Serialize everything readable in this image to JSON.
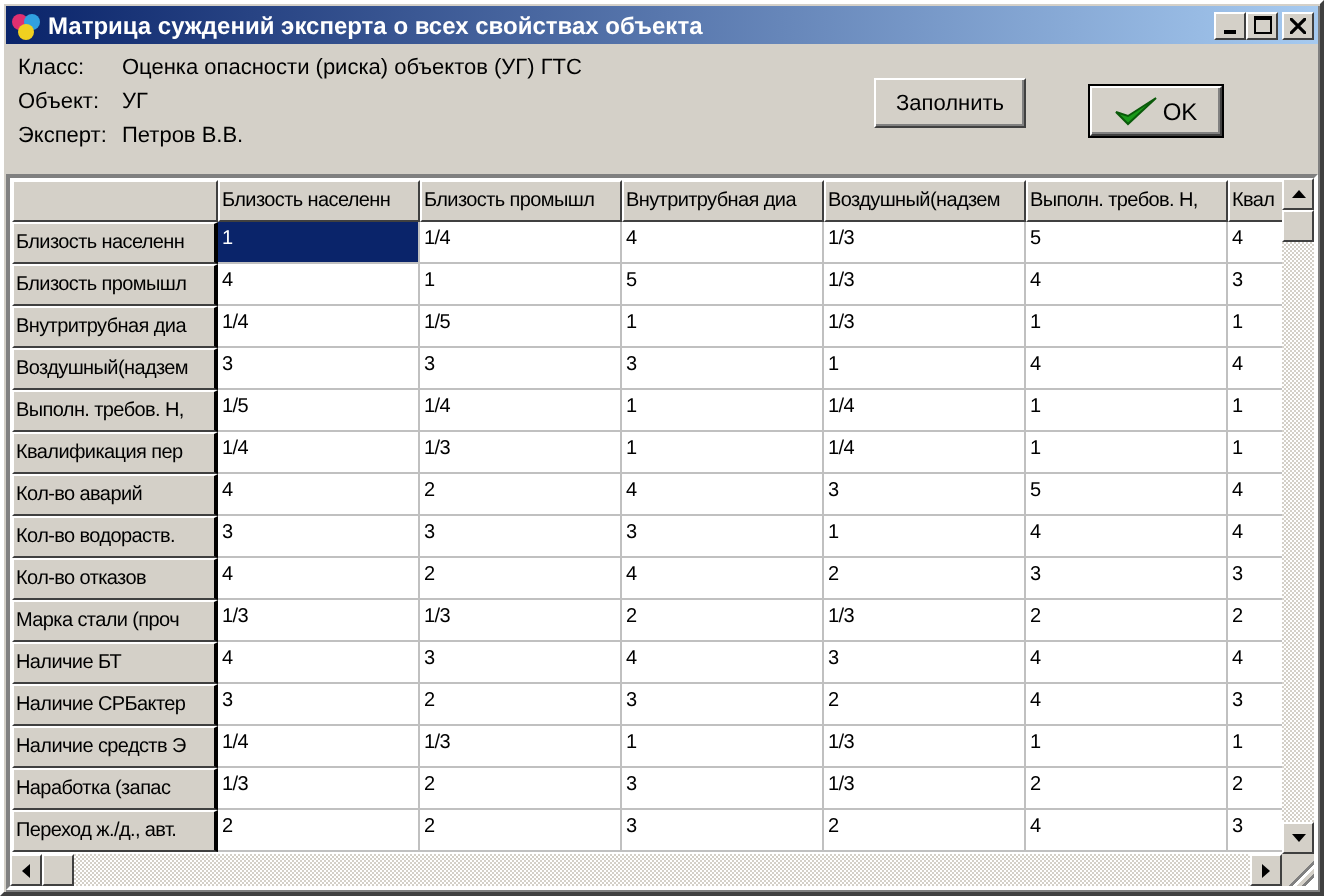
{
  "window": {
    "title": "Матрица суждений эксперта о всех свойствах объекта"
  },
  "info": [
    {
      "label": "Класс:",
      "value": "Оценка опасности (риска) объектов (УГ) ГТС"
    },
    {
      "label": "Объект:",
      "value": "УГ"
    },
    {
      "label": "Эксперт:",
      "value": "Петров В.В."
    }
  ],
  "buttons": [
    {
      "kind": "plain",
      "label": "Заполнить",
      "default": false
    },
    {
      "kind": "ok",
      "label": "OK",
      "default": true
    }
  ],
  "table": {
    "columns": [
      "Близость населенн",
      "Близость промышл",
      "Внутритрубная диа",
      "Воздушный(надзем",
      "Выполн. требов. Н,",
      "Квал"
    ],
    "rows": [
      {
        "label": "Близость населенн",
        "cells": [
          {
            "value": "1",
            "selected": true
          },
          {
            "value": "1/4",
            "selected": false
          },
          {
            "value": "4",
            "selected": false
          },
          {
            "value": "1/3",
            "selected": false
          },
          {
            "value": "5",
            "selected": false
          },
          {
            "value": "4",
            "selected": false
          }
        ]
      },
      {
        "label": "Близость промышл",
        "cells": [
          {
            "value": "4",
            "selected": false
          },
          {
            "value": "1",
            "selected": false
          },
          {
            "value": "5",
            "selected": false
          },
          {
            "value": "1/3",
            "selected": false
          },
          {
            "value": "4",
            "selected": false
          },
          {
            "value": "3",
            "selected": false
          }
        ]
      },
      {
        "label": "Внутритрубная диа",
        "cells": [
          {
            "value": "1/4",
            "selected": false
          },
          {
            "value": "1/5",
            "selected": false
          },
          {
            "value": "1",
            "selected": false
          },
          {
            "value": "1/3",
            "selected": false
          },
          {
            "value": "1",
            "selected": false
          },
          {
            "value": "1",
            "selected": false
          }
        ]
      },
      {
        "label": "Воздушный(надзем",
        "cells": [
          {
            "value": "3",
            "selected": false
          },
          {
            "value": "3",
            "selected": false
          },
          {
            "value": "3",
            "selected": false
          },
          {
            "value": "1",
            "selected": false
          },
          {
            "value": "4",
            "selected": false
          },
          {
            "value": "4",
            "selected": false
          }
        ]
      },
      {
        "label": "Выполн. требов. Н,",
        "cells": [
          {
            "value": "1/5",
            "selected": false
          },
          {
            "value": "1/4",
            "selected": false
          },
          {
            "value": "1",
            "selected": false
          },
          {
            "value": "1/4",
            "selected": false
          },
          {
            "value": "1",
            "selected": false
          },
          {
            "value": "1",
            "selected": false
          }
        ]
      },
      {
        "label": "Квалификация пер",
        "cells": [
          {
            "value": "1/4",
            "selected": false
          },
          {
            "value": "1/3",
            "selected": false
          },
          {
            "value": "1",
            "selected": false
          },
          {
            "value": "1/4",
            "selected": false
          },
          {
            "value": "1",
            "selected": false
          },
          {
            "value": "1",
            "selected": false
          }
        ]
      },
      {
        "label": "Кол-во аварий",
        "cells": [
          {
            "value": "4",
            "selected": false
          },
          {
            "value": "2",
            "selected": false
          },
          {
            "value": "4",
            "selected": false
          },
          {
            "value": "3",
            "selected": false
          },
          {
            "value": "5",
            "selected": false
          },
          {
            "value": "4",
            "selected": false
          }
        ]
      },
      {
        "label": "Кол-во водораств.",
        "cells": [
          {
            "value": "3",
            "selected": false
          },
          {
            "value": "3",
            "selected": false
          },
          {
            "value": "3",
            "selected": false
          },
          {
            "value": "1",
            "selected": false
          },
          {
            "value": "4",
            "selected": false
          },
          {
            "value": "4",
            "selected": false
          }
        ]
      },
      {
        "label": "Кол-во отказов",
        "cells": [
          {
            "value": "4",
            "selected": false
          },
          {
            "value": "2",
            "selected": false
          },
          {
            "value": "4",
            "selected": false
          },
          {
            "value": "2",
            "selected": false
          },
          {
            "value": "3",
            "selected": false
          },
          {
            "value": "3",
            "selected": false
          }
        ]
      },
      {
        "label": "Марка стали (проч",
        "cells": [
          {
            "value": "1/3",
            "selected": false
          },
          {
            "value": "1/3",
            "selected": false
          },
          {
            "value": "2",
            "selected": false
          },
          {
            "value": "1/3",
            "selected": false
          },
          {
            "value": "2",
            "selected": false
          },
          {
            "value": "2",
            "selected": false
          }
        ]
      },
      {
        "label": "Наличие БТ",
        "cells": [
          {
            "value": "4",
            "selected": false
          },
          {
            "value": "3",
            "selected": false
          },
          {
            "value": "4",
            "selected": false
          },
          {
            "value": "3",
            "selected": false
          },
          {
            "value": "4",
            "selected": false
          },
          {
            "value": "4",
            "selected": false
          }
        ]
      },
      {
        "label": "Наличие СРБактер",
        "cells": [
          {
            "value": "3",
            "selected": false
          },
          {
            "value": "2",
            "selected": false
          },
          {
            "value": "3",
            "selected": false
          },
          {
            "value": "2",
            "selected": false
          },
          {
            "value": "4",
            "selected": false
          },
          {
            "value": "3",
            "selected": false
          }
        ]
      },
      {
        "label": "Наличие средств Э",
        "cells": [
          {
            "value": "1/4",
            "selected": false
          },
          {
            "value": "1/3",
            "selected": false
          },
          {
            "value": "1",
            "selected": false
          },
          {
            "value": "1/3",
            "selected": false
          },
          {
            "value": "1",
            "selected": false
          },
          {
            "value": "1",
            "selected": false
          }
        ]
      },
      {
        "label": "Наработка (запас",
        "cells": [
          {
            "value": "1/3",
            "selected": false
          },
          {
            "value": "2",
            "selected": false
          },
          {
            "value": "3",
            "selected": false
          },
          {
            "value": "1/3",
            "selected": false
          },
          {
            "value": "2",
            "selected": false
          },
          {
            "value": "2",
            "selected": false
          }
        ]
      },
      {
        "label": "Переход ж./д., авт.",
        "cells": [
          {
            "value": "2",
            "selected": false
          },
          {
            "value": "2",
            "selected": false
          },
          {
            "value": "3",
            "selected": false
          },
          {
            "value": "2",
            "selected": false
          },
          {
            "value": "4",
            "selected": false
          },
          {
            "value": "3",
            "selected": false
          }
        ]
      }
    ]
  }
}
